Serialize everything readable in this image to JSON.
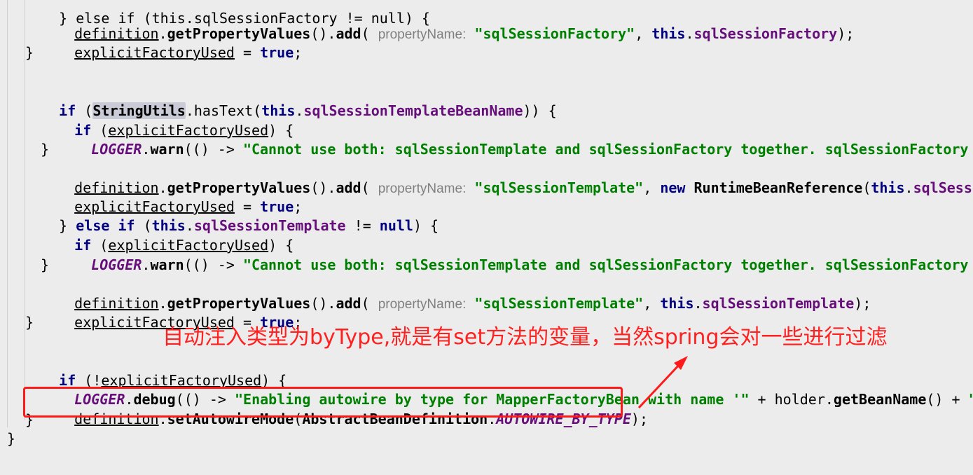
{
  "code_lines": [
    "} else if (this.sqlSessionFactory != null) {",
    "definition.getPropertyValues().add( propertyName: \"sqlSessionFactory\", this.sqlSessionFactory);",
    "explicitFactoryUsed = true;",
    "}",
    "if (StringUtils.hasText(this.sqlSessionTemplateBeanName)) {",
    "if (explicitFactoryUsed) {",
    "LOGGER.warn(() -> \"Cannot use both: sqlSessionTemplate and sqlSessionFactory together. sqlSessionFactory is i",
    "}",
    "definition.getPropertyValues().add( propertyName: \"sqlSessionTemplate\", new RuntimeBeanReference(this.sqlSession",
    "explicitFactoryUsed = true;",
    "} else if (this.sqlSessionTemplate != null) {",
    "if (explicitFactoryUsed) {",
    "LOGGER.warn(() -> \"Cannot use both: sqlSessionTemplate and sqlSessionFactory together. sqlSessionFactory is i",
    "}",
    "definition.getPropertyValues().add( propertyName: \"sqlSessionTemplate\", this.sqlSessionTemplate);",
    "explicitFactoryUsed = true;",
    "}",
    "if (!explicitFactoryUsed) {",
    "LOGGER.debug(() -> \"Enabling autowire by type for MapperFactoryBean with name '\" + holder.getBeanName() + \"'.\");",
    "definition.setAutowireMode(AbstractBeanDefinition.AUTOWIRE_BY_TYPE);",
    "}",
    "}"
  ],
  "annotation_text": "自动注入类型为byType,就是有set方法的变量，当然spring会对一些进行过滤",
  "colors": {
    "background": "#ececec",
    "annotation": "#ff2020",
    "highlight_box": "#ff1a1a",
    "keyword": "#000080",
    "string": "#008000",
    "field": "#660e7a",
    "hint": "#808080"
  }
}
